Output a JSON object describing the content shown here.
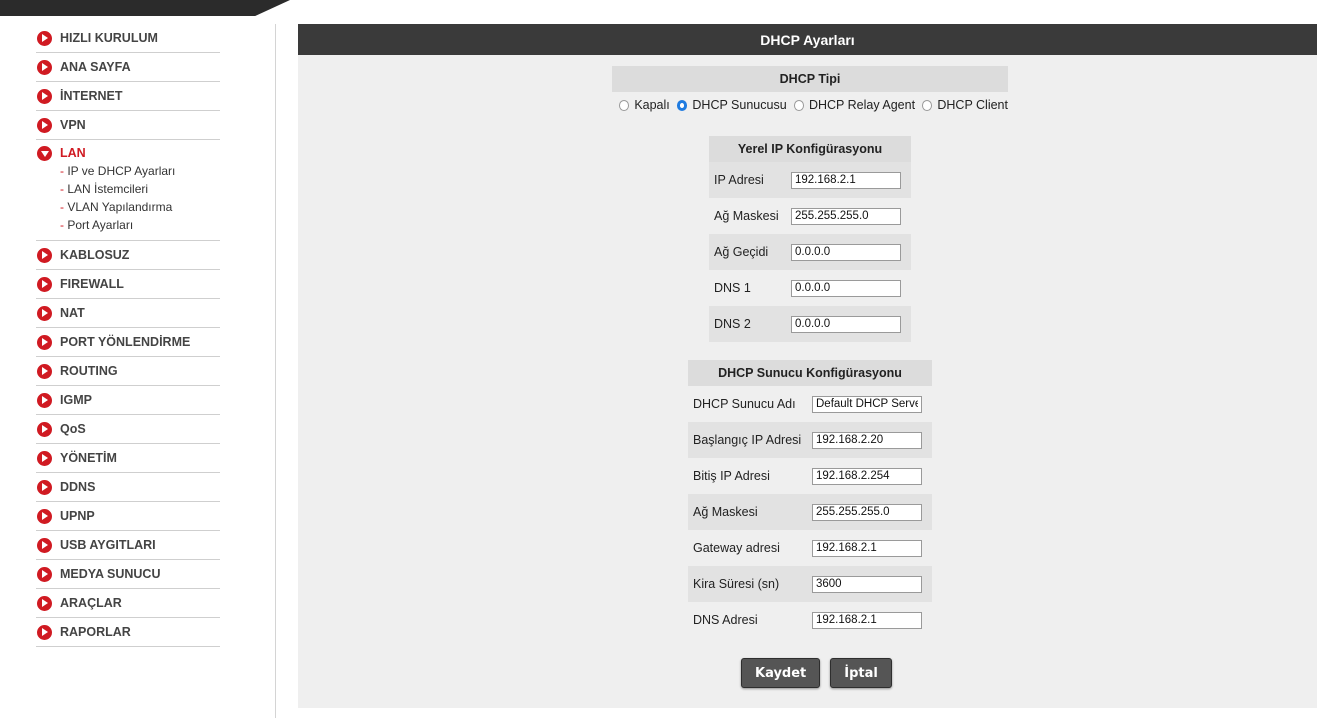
{
  "nav": {
    "items_top": [
      "HIZLI KURULUM",
      "ANA SAYFA",
      "İNTERNET",
      "VPN"
    ],
    "lan": {
      "label": "LAN",
      "subitems": [
        "IP ve DHCP Ayarları",
        "LAN İstemcileri",
        "VLAN Yapılandırma",
        "Port Ayarları"
      ]
    },
    "items_bottom": [
      "KABLOSUZ",
      "FIREWALL",
      "NAT",
      "PORT YÖNLENDİRME",
      "ROUTING",
      "IGMP",
      "QoS",
      "YÖNETİM",
      "DDNS",
      "UPNP",
      "USB AYGITLARI",
      "MEDYA SUNUCU",
      "ARAÇLAR",
      "RAPORLAR"
    ]
  },
  "main": {
    "title": "DHCP Ayarları",
    "dhcp_type": {
      "heading": "DHCP Tipi",
      "options": [
        "Kapalı",
        "DHCP Sunucusu",
        "DHCP Relay Agent",
        "DHCP Client"
      ],
      "selected": "DHCP Sunucusu"
    },
    "local_ip": {
      "heading": "Yerel IP Konfigürasyonu",
      "fields": [
        {
          "label": "IP Adresi",
          "value": "192.168.2.1"
        },
        {
          "label": "Ağ Maskesi",
          "value": "255.255.255.0"
        },
        {
          "label": "Ağ Geçidi",
          "value": "0.0.0.0"
        },
        {
          "label": "DNS 1",
          "value": "0.0.0.0"
        },
        {
          "label": "DNS 2",
          "value": "0.0.0.0"
        }
      ]
    },
    "dhcp_server": {
      "heading": "DHCP Sunucu Konfigürasyonu",
      "fields": [
        {
          "label": "DHCP Sunucu Adı",
          "value": "Default DHCP Server"
        },
        {
          "label": "Başlangıç IP Adresi",
          "value": "192.168.2.20"
        },
        {
          "label": "Bitiş IP Adresi",
          "value": "192.168.2.254"
        },
        {
          "label": "Ağ Maskesi",
          "value": "255.255.255.0"
        },
        {
          "label": "Gateway adresi",
          "value": "192.168.2.1"
        },
        {
          "label": "Kira Süresi (sn)",
          "value": "3600"
        },
        {
          "label": "DNS Adresi",
          "value": "192.168.2.1"
        }
      ]
    },
    "buttons": {
      "save": "Kaydet",
      "cancel": "İptal"
    }
  },
  "colors": {
    "accent": "#d01a22",
    "header_bg": "#3a3a3a",
    "panel_bg": "#efefef",
    "radio_selected": "#1f7be0"
  }
}
